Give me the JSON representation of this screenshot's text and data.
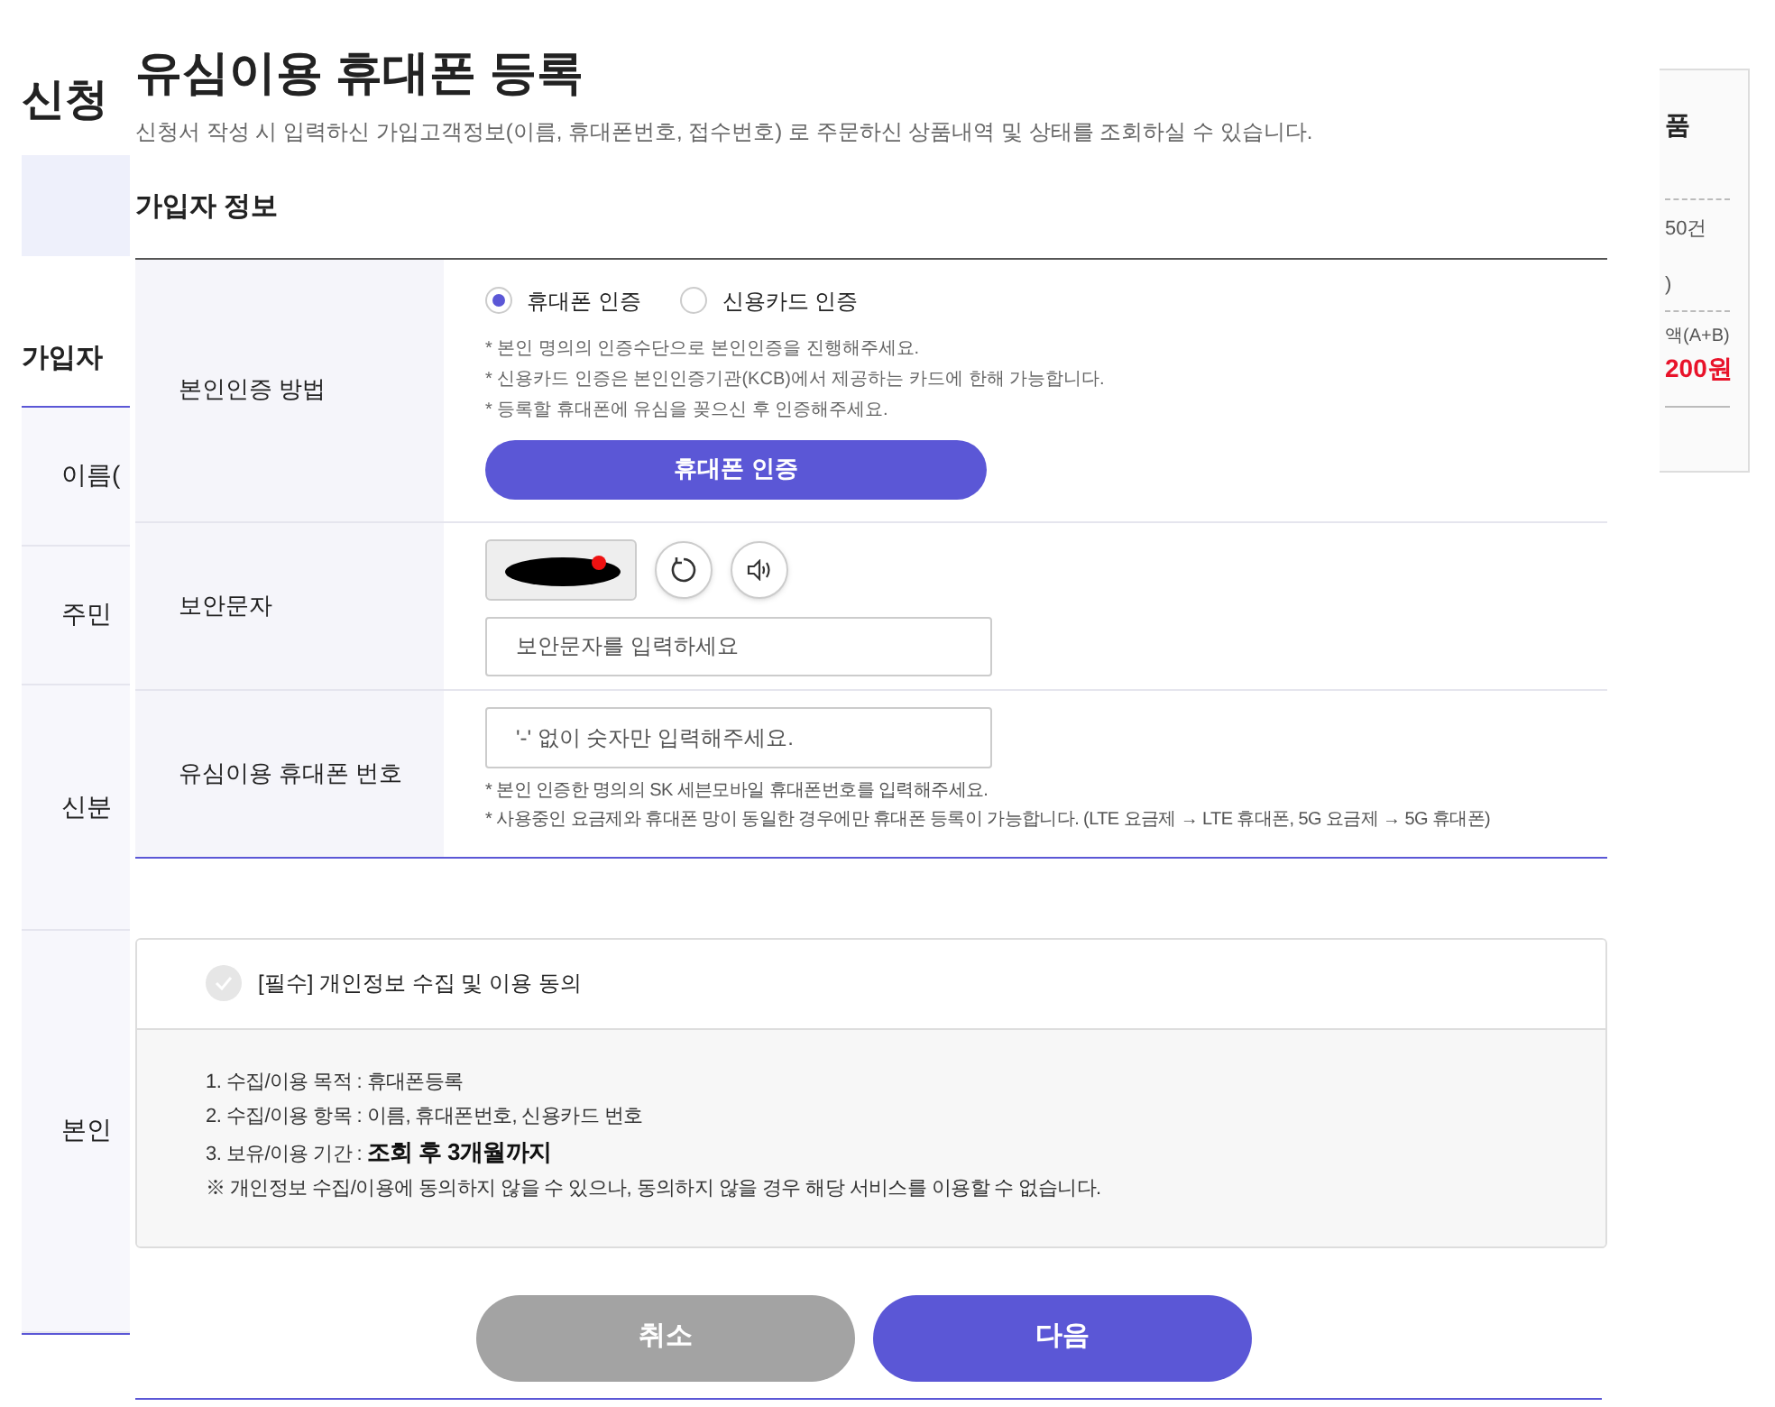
{
  "background": {
    "page_title": "신청",
    "section_title": "가입자",
    "row_labels": [
      "이름(",
      "주민",
      "신분",
      "본인"
    ],
    "summary": {
      "heading": "품",
      "count": "50건",
      "note": ")",
      "total_label": "액(A+B)",
      "total": "200원"
    }
  },
  "modal": {
    "title": "유심이용 휴대폰 등록",
    "subtitle": "신청서 작성 시 입력하신 가입고객정보(이름, 휴대폰번호, 접수번호) 로 주문하신 상품내역 및 상태를 조회하실 수 있습니다.",
    "section": "가입자 정보",
    "auth": {
      "label": "본인인증 방법",
      "options": [
        {
          "label": "휴대폰 인증",
          "selected": true
        },
        {
          "label": "신용카드 인증",
          "selected": false
        }
      ],
      "notes": [
        "* 본인 명의의 인증수단으로 본인인증을 진행해주세요.",
        "* 신용카드 인증은 본인인증기관(KCB)에서 제공하는 카드에 한해 가능합니다.",
        "* 등록할 휴대폰에 유심을 꽂으신 후 인증해주세요."
      ],
      "button": "휴대폰 인증"
    },
    "captcha": {
      "label": "보안문자",
      "placeholder": "보안문자를 입력하세요"
    },
    "phone": {
      "label": "유심이용 휴대폰 번호",
      "placeholder": "'-' 없이 숫자만 입력해주세요.",
      "notes": [
        "* 본인 인증한 명의의 SK 세븐모바일 휴대폰번호를 입력해주세요.",
        "* 사용중인 요금제와 휴대폰 망이 동일한 경우에만 휴대폰 등록이 가능합니다. (LTE 요금제 → LTE 휴대폰, 5G 요금제 → 5G 휴대폰)"
      ]
    },
    "consent": {
      "label": "[필수] 개인정보 수집 및 이용 동의",
      "checked": false,
      "items": [
        "1. 수집/이용 목적 : 휴대폰등록",
        "2. 수집/이용 항목 : 이름, 휴대폰번호, 신용카드 번호",
        "3. 보유/이용 기간 : **조회 후 3개월까지**",
        "※ 개인정보 수집/이용에 동의하지 않을 수 있으나, 동의하지 않을 경우 해당 서비스를 이용할 수 없습니다."
      ]
    },
    "buttons": [
      {
        "label": "취소",
        "kind": "secondary"
      },
      {
        "label": "다음",
        "kind": "primary"
      }
    ]
  }
}
